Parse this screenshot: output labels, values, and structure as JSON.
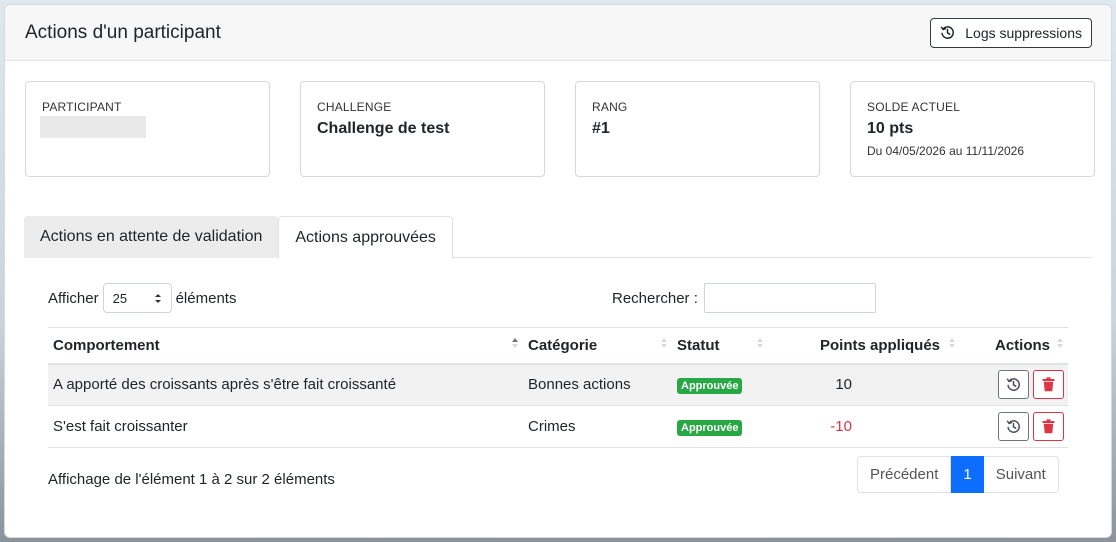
{
  "header": {
    "title": "Actions d'un participant",
    "logs_button": "Logs suppressions"
  },
  "stats": {
    "participant_label": "PARTICIPANT",
    "challenge_label": "CHALLENGE",
    "challenge_value": "Challenge de test",
    "rank_label": "RANG",
    "rank_value": "#1",
    "balance_label": "SOLDE ACTUEL",
    "balance_value": "10 pts",
    "balance_period": "Du 04/05/2026 au 11/11/2026"
  },
  "tabs": [
    {
      "label": "Actions en attente de validation",
      "active": false
    },
    {
      "label": "Actions approuvées",
      "active": true
    }
  ],
  "controls": {
    "show_label": "Afficher",
    "page_size": "25",
    "elements_label": "éléments",
    "search_label": "Rechercher :",
    "search_value": ""
  },
  "table": {
    "columns": [
      "Comportement",
      "Catégorie",
      "Statut",
      "Points appliqués",
      "Actions"
    ],
    "rows": [
      {
        "behavior": "A apporté des croissants après s'être fait croissanté",
        "category": "Bonnes actions",
        "status": "Approuvée",
        "points": "10"
      },
      {
        "behavior": "S'est fait croissanter",
        "category": "Crimes",
        "status": "Approuvée",
        "points": "-10"
      }
    ]
  },
  "footer": {
    "info": "Affichage de l'élément 1 à 2 sur 2 éléments",
    "prev": "Précédent",
    "current_page": "1",
    "next": "Suivant"
  },
  "colors": {
    "badge": "#28a745",
    "negative": "#dc3545",
    "primary": "#0d6efd"
  }
}
